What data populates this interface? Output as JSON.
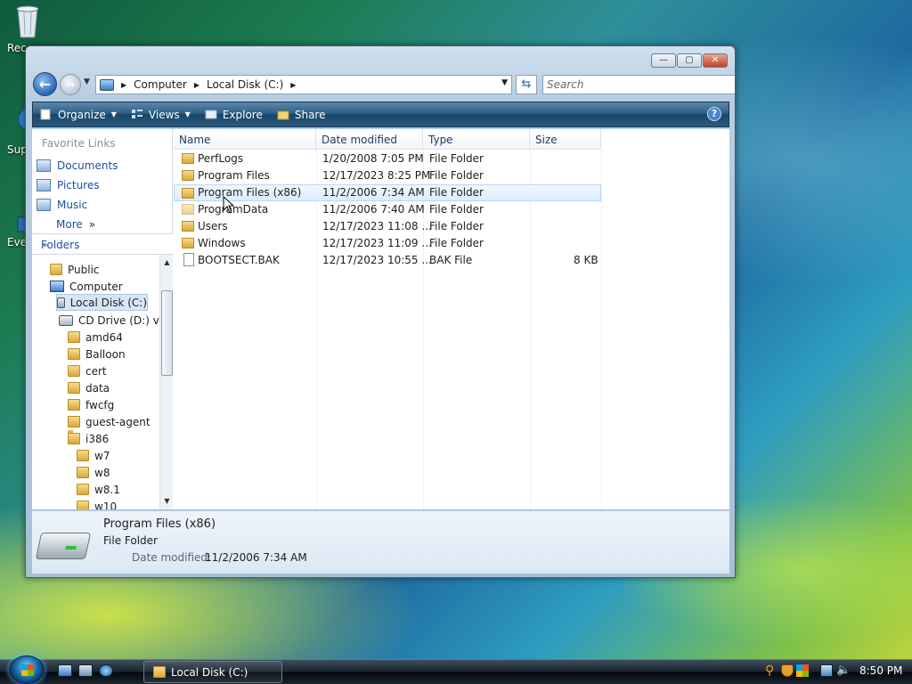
{
  "desktop": {
    "icons": [
      {
        "label": "Rec",
        "name": "recycle-bin"
      },
      {
        "label": "Sup",
        "name": "support"
      },
      {
        "label": "Eve",
        "name": "event-viewer"
      }
    ]
  },
  "window": {
    "breadcrumb": [
      "Computer",
      "Local Disk (C:)"
    ],
    "search_placeholder": "Search",
    "toolbar": {
      "organize": "Organize",
      "views": "Views",
      "explore": "Explore",
      "share": "Share"
    },
    "favorites": {
      "title": "Favorite Links",
      "items": [
        "Documents",
        "Pictures",
        "Music",
        "More"
      ]
    },
    "folders": {
      "title": "Folders",
      "tree": [
        "Public",
        "Computer",
        "Local Disk (C:)",
        "CD Drive (D:) virt",
        "amd64",
        "Balloon",
        "cert",
        "data",
        "fwcfg",
        "guest-agent",
        "i386",
        "w7",
        "w8",
        "w8.1",
        "w10"
      ]
    },
    "columns": [
      "Name",
      "Date modified",
      "Type",
      "Size"
    ],
    "files": [
      {
        "name": "PerfLogs",
        "date": "1/20/2008 7:05 PM",
        "type": "File Folder",
        "size": ""
      },
      {
        "name": "Program Files",
        "date": "12/17/2023 8:25 PM",
        "type": "File Folder",
        "size": ""
      },
      {
        "name": "Program Files (x86)",
        "date": "11/2/2006 7:34 AM",
        "type": "File Folder",
        "size": ""
      },
      {
        "name": "ProgramData",
        "date": "11/2/2006 7:40 AM",
        "type": "File Folder",
        "size": ""
      },
      {
        "name": "Users",
        "date": "12/17/2023 11:08 ...",
        "type": "File Folder",
        "size": ""
      },
      {
        "name": "Windows",
        "date": "12/17/2023 11:09 ...",
        "type": "File Folder",
        "size": ""
      },
      {
        "name": "BOOTSECT.BAK",
        "date": "12/17/2023 10:55 ...",
        "type": "BAK File",
        "size": "8 KB"
      }
    ],
    "details": {
      "name": "Program Files (x86)",
      "type": "File Folder",
      "modified_label": "Date modified:",
      "modified_value": "11/2/2006 7:34 AM"
    }
  },
  "taskbar": {
    "task_label": "Local Disk (C:)",
    "clock": "8:50 PM"
  }
}
